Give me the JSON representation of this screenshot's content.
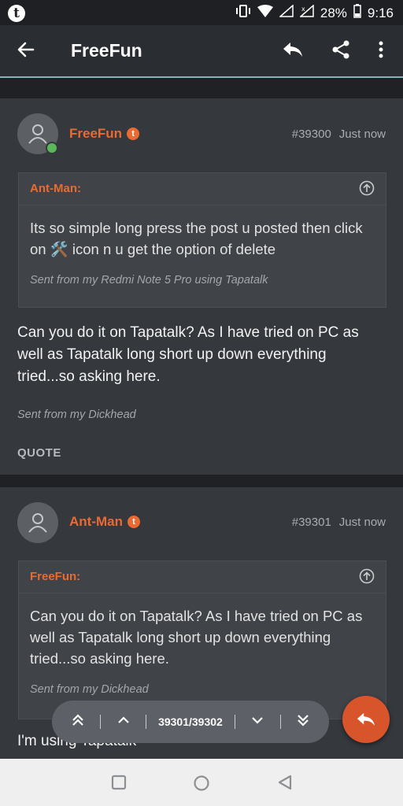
{
  "status_bar": {
    "battery": "28%",
    "time": "9:16",
    "app_icon": "tapatalk-t-icon"
  },
  "app_bar": {
    "title": "FreeFun",
    "icons": [
      "back-arrow-icon",
      "reply-icon",
      "share-icon",
      "more-vert-icon"
    ]
  },
  "posts": [
    {
      "author": "FreeFun",
      "badge": "t",
      "post_number": "#39300",
      "time": "Just now",
      "online": true,
      "quote": {
        "author": "Ant-Man:",
        "text": "Its so simple long press the post u posted then click on 🛠️ icon n u get the option of delete",
        "signature": "Sent from my Redmi Note 5 Pro using Tapatalk"
      },
      "body": "Can you do it on Tapatalk? As I have tried on PC as well as Tapatalk long short up down everything tried...so asking here.",
      "signature": "Sent from my Dickhead",
      "quote_label": "QUOTE"
    },
    {
      "author": "Ant-Man",
      "badge": "t",
      "post_number": "#39301",
      "time": "Just now",
      "online": false,
      "quote": {
        "author": "FreeFun:",
        "text": "Can you do it on Tapatalk? As I have tried on PC as well as Tapatalk long short up down everything tried...so asking here.",
        "signature": "Sent from my Dickhead"
      },
      "body": "I'm using Tapatalk"
    }
  ],
  "pager": {
    "label": "39301/39302",
    "icons": [
      "first-page-icon",
      "prev-page-icon",
      "next-page-icon",
      "last-page-icon"
    ]
  },
  "fab": {
    "icon": "reply-icon"
  },
  "nav_bar": {
    "icons": [
      "recents-square-icon",
      "home-circle-icon",
      "back-triangle-icon"
    ]
  },
  "colors": {
    "accent": "#ea6a32",
    "fab": "#d8542a",
    "divider": "#7fb5b5"
  }
}
